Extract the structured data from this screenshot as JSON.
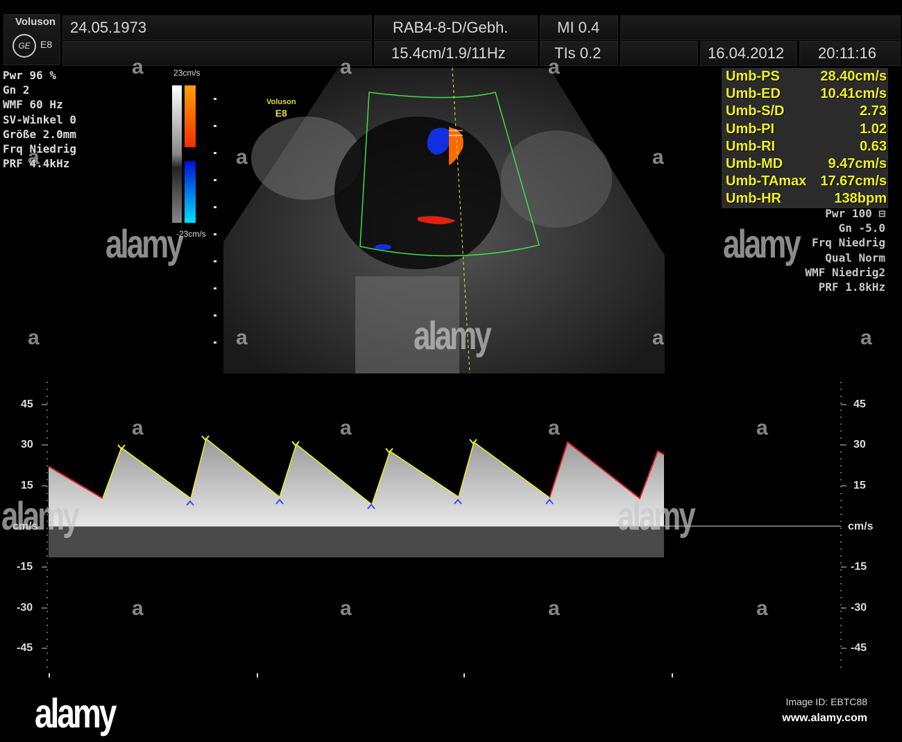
{
  "header": {
    "brand": "Voluson",
    "model": "E8",
    "logo": "GE",
    "patient_dob": "24.05.1973",
    "probe": "RAB4-8-D/Gebh.",
    "mi": "MI 0.4",
    "depth_info": "15.4cm/1.9/11Hz",
    "tis": "TIs 0.2",
    "date": "16.04.2012",
    "time": "20:11:16"
  },
  "left_params": [
    "Pwr  96 %",
    "Gn   2",
    "WMF 60 Hz",
    "SV-Winkel  0",
    "Größe  2.0mm",
    "Frq Niedrig",
    "PRF  4.4kHz"
  ],
  "color_scale": {
    "top": "23cm/s",
    "bottom": "-23cm/s"
  },
  "image_label": {
    "brand": "Voluson",
    "model": "E8"
  },
  "measurements": [
    {
      "label": "Umb-PS",
      "value": "28.40cm/s"
    },
    {
      "label": "Umb-ED",
      "value": "10.41cm/s"
    },
    {
      "label": "Umb-S/D",
      "value": "2.73"
    },
    {
      "label": "Umb-PI",
      "value": "1.02"
    },
    {
      "label": "Umb-RI",
      "value": "0.63"
    },
    {
      "label": "Umb-MD",
      "value": "9.47cm/s"
    },
    {
      "label": "Umb-TAmax",
      "value": "17.67cm/s"
    },
    {
      "label": "Umb-HR",
      "value": "138bpm"
    }
  ],
  "right_params": [
    "Pwr 100 ⊟",
    "Gn -5.0",
    "Frq Niedrig",
    "Qual Norm",
    "WMF Niedrig2",
    "PRF  1.8kHz"
  ],
  "spectrum_axis": {
    "unit": "cm/s",
    "ticks": [
      "45",
      "30",
      "15",
      "-15",
      "-30",
      "-45"
    ]
  },
  "watermark": {
    "brand": "alamy",
    "image_id": "Image ID: EBTC88",
    "url": "www.alamy.com"
  },
  "colors": {
    "measure_text": "#f0f020",
    "trace": "#f0f020",
    "trace_red": "#e02020",
    "sector": "#40e040"
  }
}
